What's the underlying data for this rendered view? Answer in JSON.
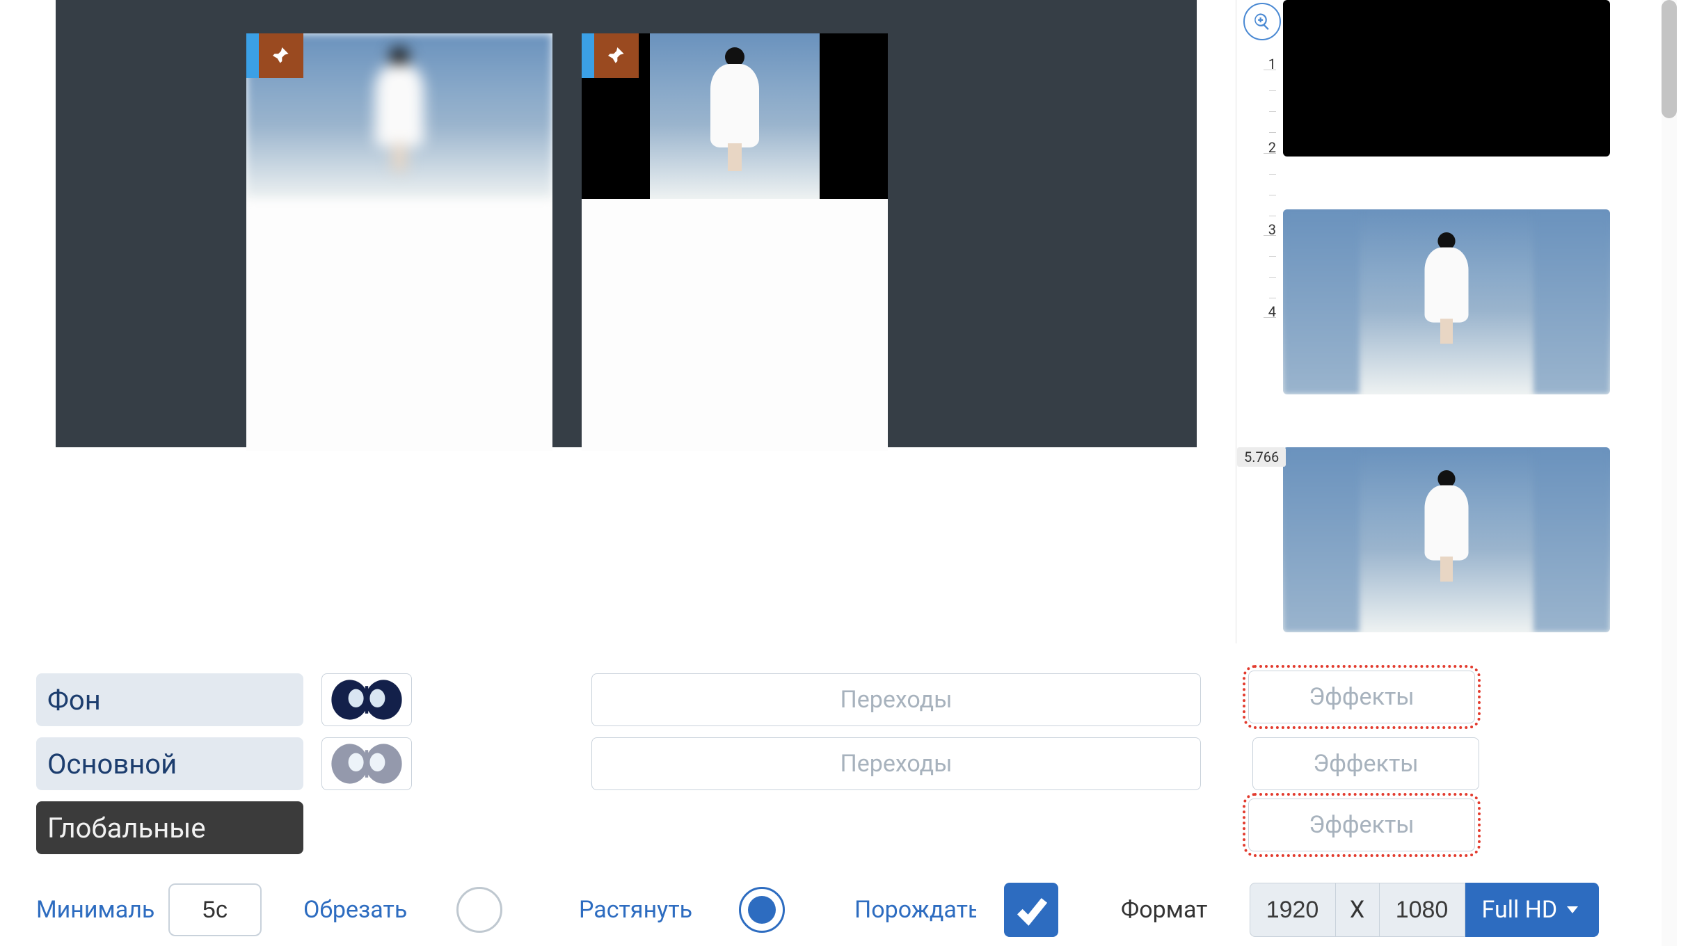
{
  "ruler": {
    "ticks": [
      "1",
      "2",
      "3",
      "4"
    ],
    "clip_badge": "5.766"
  },
  "layers": {
    "background": {
      "label": "Фон",
      "transitions": "Переходы",
      "effects": "Эффекты"
    },
    "main": {
      "label": "Основной",
      "transitions": "Переходы",
      "effects": "Эффекты"
    },
    "global": {
      "label": "Глобальные",
      "effects": "Эффекты"
    }
  },
  "footer": {
    "minimal_label": "Минималь",
    "minimal_value": "5с",
    "crop_label": "Обрезать",
    "stretch_label": "Растянуть",
    "spawn_label": "Порождать",
    "format_label": "Формат",
    "width": "1920",
    "sep": "X",
    "height": "1080",
    "preset": "Full HD"
  },
  "icons": {
    "pin": "pin-icon",
    "zoom": "zoom-in-icon",
    "check": "check-icon",
    "caret": "caret-down-icon"
  }
}
